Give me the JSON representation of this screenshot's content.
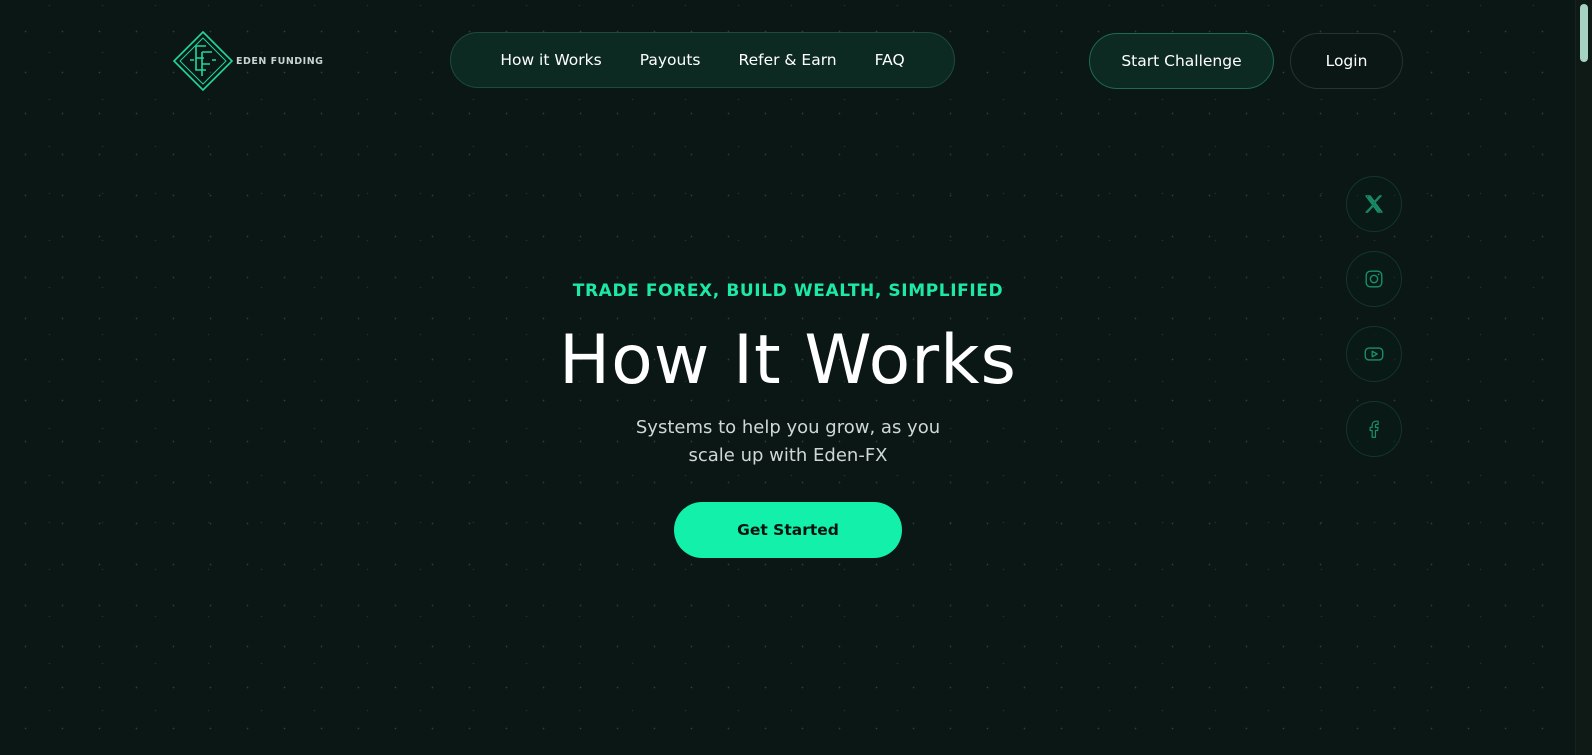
{
  "brand": {
    "name": "EDEN FUNDING",
    "logo_icon": "eden-monogram-icon"
  },
  "nav": {
    "items": [
      {
        "label": "How it Works"
      },
      {
        "label": "Payouts"
      },
      {
        "label": "Refer & Earn"
      },
      {
        "label": "FAQ"
      }
    ]
  },
  "header_actions": {
    "start_challenge": "Start Challenge",
    "login": "Login"
  },
  "social": [
    {
      "name": "x-twitter-icon"
    },
    {
      "name": "instagram-icon"
    },
    {
      "name": "youtube-icon"
    },
    {
      "name": "facebook-icon"
    }
  ],
  "hero": {
    "kicker": "TRADE FOREX, BUILD WEALTH, SIMPLIFIED",
    "title": "How It Works",
    "subtitle_line1": "Systems to help you grow, as you",
    "subtitle_line2": "scale up with Eden-FX",
    "cta": "Get Started"
  },
  "colors": {
    "background": "#0a1714",
    "accent": "#12f0aa",
    "accent_text": "#1de9a6",
    "nav_bg": "#0d2a22"
  }
}
